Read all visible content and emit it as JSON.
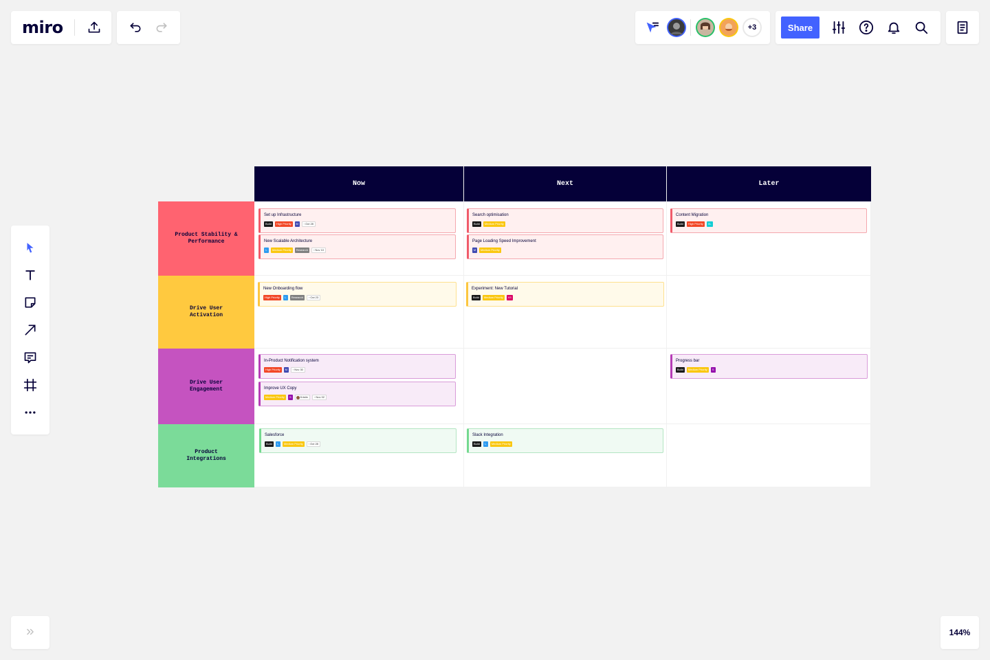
{
  "app": {
    "logo": "miro",
    "zoom": "144%",
    "share_label": "Share",
    "collaborators_more": "+3"
  },
  "icons": {
    "export": "upload-icon",
    "undo": "undo-icon",
    "redo": "redo-icon",
    "follow": "cursor-follow-icon",
    "settings": "sliders-icon",
    "help": "help-icon",
    "notifications": "bell-icon",
    "search": "search-icon",
    "notes": "notes-icon"
  },
  "toolbar": {
    "items": [
      "select-tool",
      "text-tool",
      "sticky-note-tool",
      "connector-tool",
      "comment-tool",
      "frame-tool",
      "more-tools"
    ]
  },
  "board": {
    "columns": [
      "Now",
      "Next",
      "Later"
    ],
    "rows": [
      {
        "label_line1": "Product Stability &",
        "label_line2": "Performance",
        "color": "#ff6370"
      },
      {
        "label_line1": "Drive User",
        "label_line2": "Activation",
        "color": "#ffc93f"
      },
      {
        "label_line1": "Drive User",
        "label_line2": "Engagement",
        "color": "#c553c0"
      },
      {
        "label_line1": "Product",
        "label_line2": "Integrations",
        "color": "#7bdb99"
      }
    ],
    "cards": {
      "r0c0a": {
        "title": "Set up Infrastructure",
        "tags": [
          "Build",
          "High Priority",
          "M",
          "Oct 28"
        ]
      },
      "r0c0b": {
        "title": "New Scalable Architecture",
        "tags": [
          "L",
          "Medium Priority",
          "Research",
          "Nov 10"
        ]
      },
      "r0c1a": {
        "title": "Search optimisation",
        "tags": [
          "Build",
          "Medium Priority"
        ]
      },
      "r0c1b": {
        "title": "Page Loading Speed Improvement",
        "tags": [
          "M",
          "Medium Priority"
        ]
      },
      "r0c2a": {
        "title": "Content Migration",
        "tags": [
          "Build",
          "High Priority",
          "XL"
        ]
      },
      "r1c0a": {
        "title": "New Onboarding flow",
        "tags": [
          "High Priority",
          "L",
          "Research",
          "Oct 23"
        ]
      },
      "r1c1a": {
        "title": "Experiment: New Tutorial",
        "tags": [
          "Build",
          "Medium Priority",
          "XS"
        ]
      },
      "r2c0a": {
        "title": "In-Product Notification system",
        "tags": [
          "High Priority",
          "M",
          "Nov 30"
        ]
      },
      "r2c0b": {
        "title": "Improve UX Copy",
        "tags": [
          "Medium Priority",
          "S",
          "Kristin",
          "Nov 02"
        ]
      },
      "r2c2a": {
        "title": "Progress bar",
        "tags": [
          "Build",
          "Medium Priority",
          "S"
        ]
      },
      "r3c0a": {
        "title": "Salesforce",
        "tags": [
          "Build",
          "L",
          "Medium Priority",
          "Oct 28"
        ]
      },
      "r3c1a": {
        "title": "Slack Integration",
        "tags": [
          "Build",
          "L",
          "Medium Priority"
        ]
      }
    }
  },
  "colors": {
    "accent": "#4262ff",
    "header": "#050038",
    "high_priority": "#f24726",
    "medium_priority": "#fac710",
    "size_m": "#414bb2",
    "size_l": "#2d9bf0",
    "size_xl": "#12cdd4",
    "size_xs": "#da0063",
    "size_s": "#9510ac"
  }
}
